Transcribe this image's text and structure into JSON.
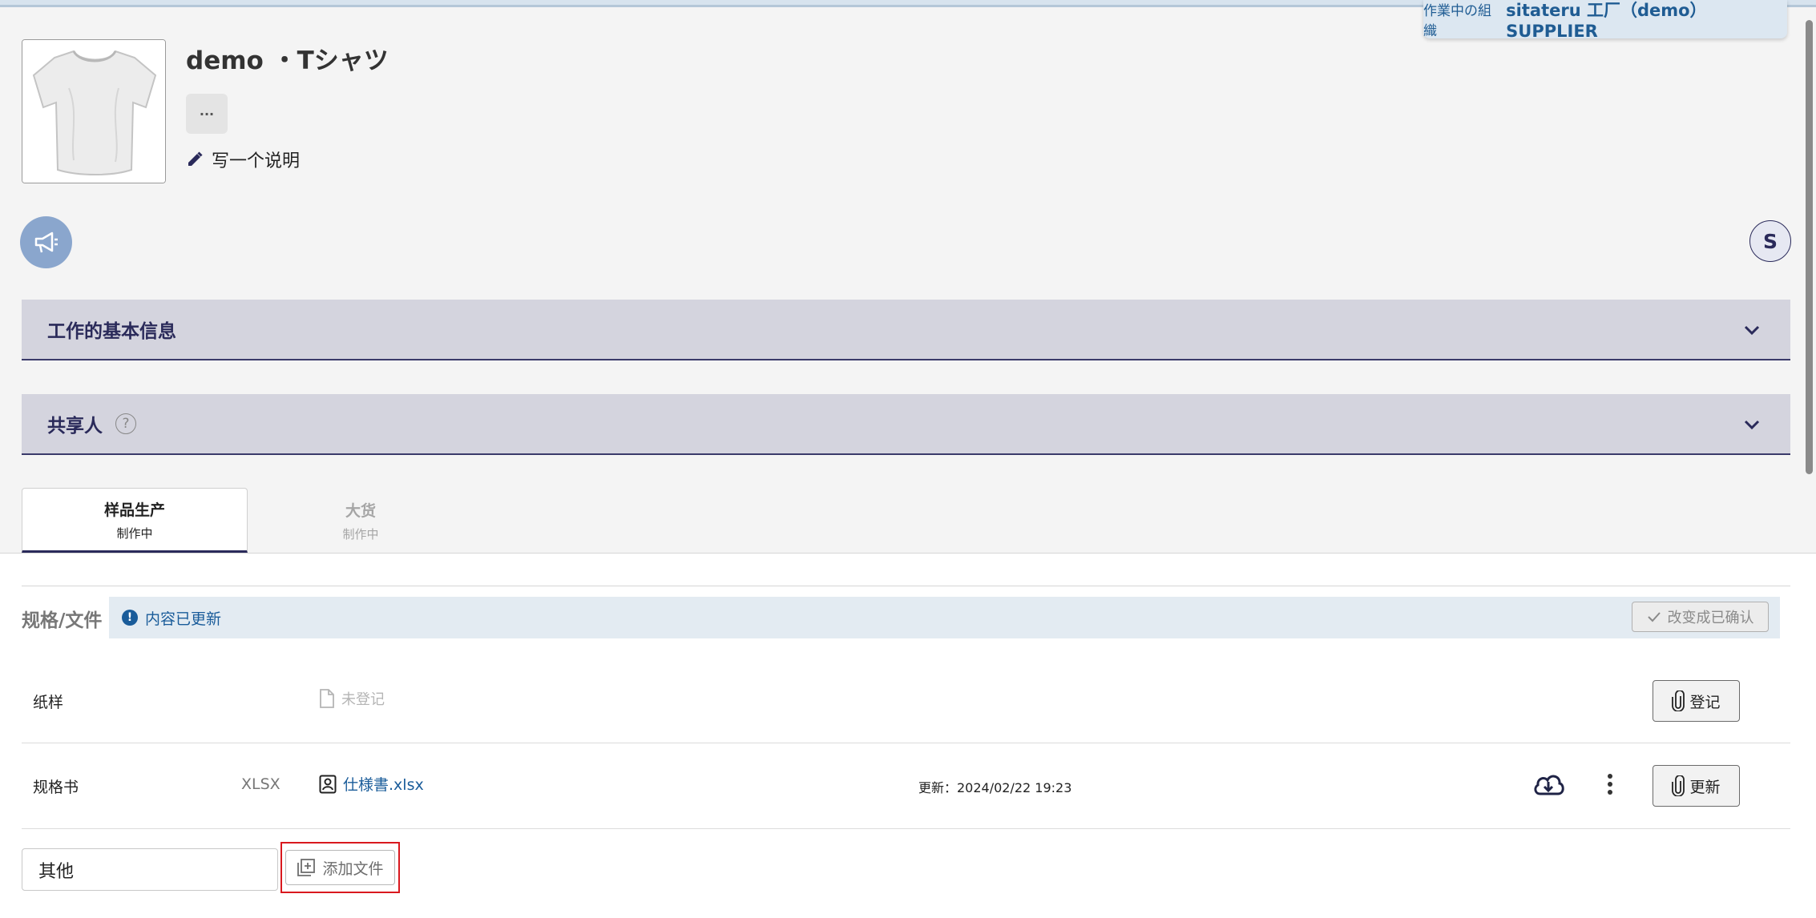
{
  "org": {
    "label": "作業中の組織",
    "value": "sitateru 工厂（demo） SUPPLIER"
  },
  "product": {
    "title": "demo ・Tシャツ",
    "write_description": "写一个说明",
    "more_label": "···"
  },
  "user": {
    "avatar_initial": "S"
  },
  "sections": {
    "basic_info": "工作的基本信息",
    "sharers": "共享人"
  },
  "tabs": [
    {
      "label": "样品生产",
      "status": "制作中"
    },
    {
      "label": "大货",
      "status": "制作中"
    }
  ],
  "specs": {
    "title": "规格/文件",
    "notice": "内容已更新",
    "confirm_label": "改变成已确认",
    "rows": [
      {
        "name": "纸样",
        "type": "",
        "file": "未登记",
        "updated": "",
        "action": "登记"
      },
      {
        "name": "规格书",
        "type": "XLSX",
        "file": "仕様書.xlsx",
        "updated": "更新：2024/02/22 19:23",
        "action": "更新"
      }
    ],
    "other_input_value": "其他",
    "add_file_label": "添加文件"
  },
  "colors": {
    "accent": "#1a5c9a",
    "navy": "#2a2a5a",
    "highlight": "#d9181e"
  }
}
